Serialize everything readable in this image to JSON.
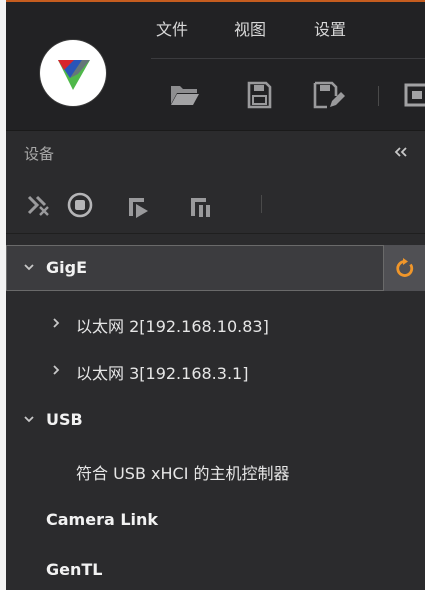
{
  "menu": {
    "file": "文件",
    "view": "视图",
    "settings": "设置"
  },
  "toolbar_icons": [
    "open-folder-icon",
    "save-icon",
    "save-as-icon",
    "window-icon"
  ],
  "panel": {
    "title": "设备",
    "toolbar_icons": [
      "disconnect-icon",
      "stop-icon",
      "start-grab-icon",
      "stop-grab-icon"
    ]
  },
  "tree": {
    "gige": {
      "label": "GigE",
      "children": [
        "以太网 2[192.168.10.83]",
        "以太网 3[192.168.3.1]"
      ]
    },
    "usb": {
      "label": "USB",
      "children": [
        "符合 USB xHCI 的主机控制器"
      ]
    },
    "camera_link": {
      "label": "Camera Link"
    },
    "gentl": {
      "label": "GenTL"
    }
  },
  "colors": {
    "accent": "#f0962a",
    "top_line": "#c65d1f",
    "background": "#2b2b2d",
    "titlebar": "#222224",
    "selected_row": "#3c3c3f"
  }
}
